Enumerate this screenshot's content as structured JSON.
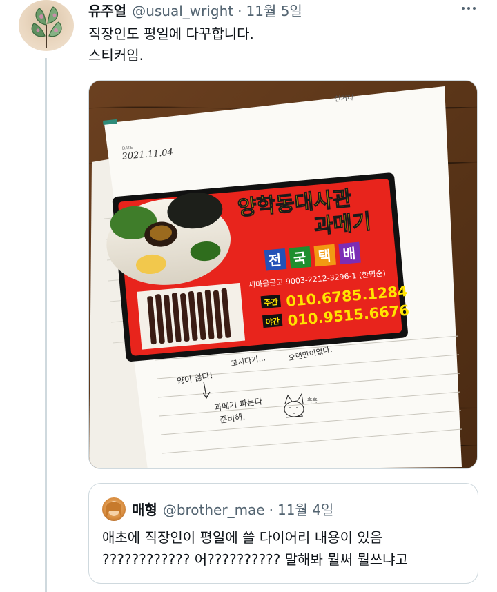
{
  "tweet": {
    "author_name": "유주얼",
    "author_handle": "@usual_wright",
    "separator": "·",
    "time": "11월 5일",
    "text": "직장인도 평일에 다꾸합니다.\n스티커임.",
    "more_icon": "more-horizontal-icon"
  },
  "photo": {
    "notebook_brand": "한거래",
    "date_label": "DATE",
    "date_value": "2021.11.04",
    "sticker": {
      "title_line1": "양학동대사관",
      "title_line2": "과메기",
      "delivery_chars": [
        "전",
        "국",
        "택",
        "배"
      ],
      "bank_account": "새마을금고 9003-2212-3296-1 (한명순)",
      "day_label": "주간",
      "day_phone": "010.6785.1284",
      "night_label": "야간",
      "night_phone": "010.9515.6676"
    },
    "handwriting": {
      "line1_a": "양이 않다!",
      "line1_b": "꼬시다기...",
      "line1_c": "오랜만이었다.",
      "line2": "과메기 파는다",
      "line3": "준비해.",
      "cat_note": "흑흑"
    },
    "colors": {
      "wood": "#5a3518",
      "sticker_red": "#e8241c",
      "title_yellow": "#ffe400"
    }
  },
  "quote": {
    "author_name": "매형",
    "author_handle": "@brother_mae",
    "separator": "·",
    "time": "11월 4일",
    "text": "애초에 직장인이 평일에 쓸 다이어리 내용이 있음\n???????????? 어?????????? 말해봐 뭘써 뭘쓰냐고"
  }
}
